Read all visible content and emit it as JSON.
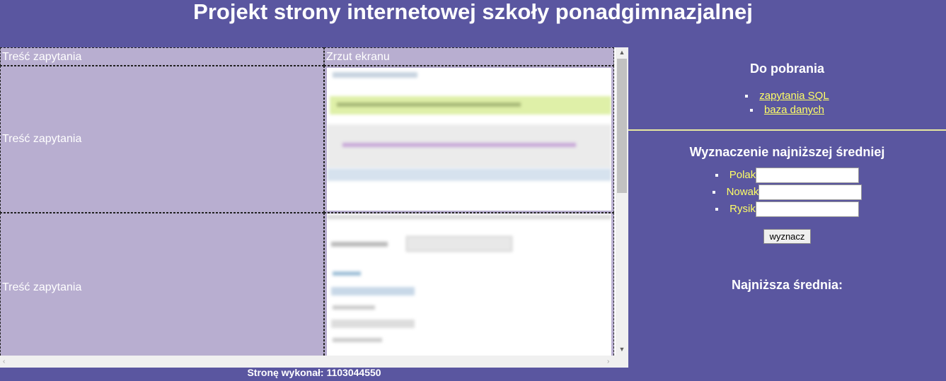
{
  "header": {
    "title": "Projekt strony internetowej szkoły ponadgimnazjalnej"
  },
  "table": {
    "headers": [
      "Treść zapytania",
      "Zrzut ekranu"
    ],
    "rows": [
      {
        "query": "Treść zapytania"
      },
      {
        "query": "Treść zapytania"
      }
    ]
  },
  "sidebar": {
    "downloads": {
      "title": "Do pobrania",
      "links": [
        "zapytania SQL",
        "baza danych"
      ]
    },
    "average": {
      "title": "Wyznaczenie najniższej średniej",
      "students": [
        "Polak",
        "Nowak",
        "Rysik"
      ],
      "button": "wyznacz"
    },
    "result": {
      "title": "Najniższa średnia:"
    }
  },
  "footer": {
    "text": "Stronę wykonał: 1103044550"
  },
  "colors": {
    "background": "#5a56a0",
    "cell": "#b8aed0",
    "link": "#ffff66"
  }
}
